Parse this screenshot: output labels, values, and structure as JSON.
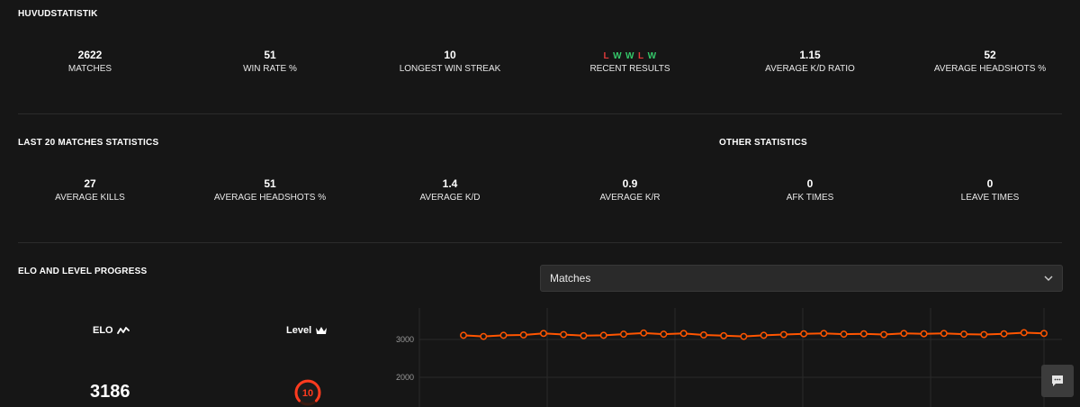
{
  "main_stats": {
    "title": "HUVUDSTATISTIK",
    "items": [
      {
        "value": "2622",
        "label": "MATCHES"
      },
      {
        "value": "51",
        "label": "WIN RATE %"
      },
      {
        "value": "10",
        "label": "LONGEST WIN STREAK"
      },
      {
        "value": "",
        "label": "RECENT RESULTS"
      },
      {
        "value": "1.15",
        "label": "AVERAGE K/D RATIO"
      },
      {
        "value": "52",
        "label": "AVERAGE HEADSHOTS %"
      }
    ],
    "recent_results": [
      "L",
      "W",
      "W",
      "L",
      "W"
    ]
  },
  "last20": {
    "title": "LAST 20 MATCHES STATISTICS",
    "other_title": "OTHER STATISTICS",
    "items": [
      {
        "value": "27",
        "label": "AVERAGE KILLS"
      },
      {
        "value": "51",
        "label": "AVERAGE HEADSHOTS %"
      },
      {
        "value": "1.4",
        "label": "AVERAGE K/D"
      },
      {
        "value": "0.9",
        "label": "AVERAGE K/R"
      },
      {
        "value": "0",
        "label": "AFK TIMES"
      },
      {
        "value": "0",
        "label": "LEAVE TIMES"
      }
    ]
  },
  "progress": {
    "title": "ELO AND LEVEL PROGRESS",
    "dropdown_value": "Matches",
    "elo_label": "ELO",
    "elo_value": "3186",
    "level_label": "Level",
    "level_value": "10"
  },
  "colors": {
    "background": "#161616",
    "accent": "#ff5500",
    "loss": "#e03a3a",
    "win": "#35c96b"
  },
  "icons": {
    "elo": "trend-line-icon",
    "level": "crown-icon",
    "dropdown": "chevron-down-icon",
    "chat": "chat-bubble-icon"
  },
  "chart_data": {
    "type": "line",
    "title": "",
    "xlabel": "",
    "ylabel": "",
    "ylim": [
      1500,
      3500
    ],
    "yticks": [
      "3000",
      "2000"
    ],
    "series": [
      {
        "values": [
          3110,
          3080,
          3110,
          3120,
          3160,
          3130,
          3100,
          3110,
          3140,
          3170,
          3140,
          3160,
          3120,
          3100,
          3080,
          3110,
          3130,
          3150,
          3160,
          3140,
          3150,
          3130,
          3160,
          3150,
          3160,
          3140,
          3130,
          3150,
          3180,
          3160
        ]
      }
    ],
    "grid": true
  }
}
